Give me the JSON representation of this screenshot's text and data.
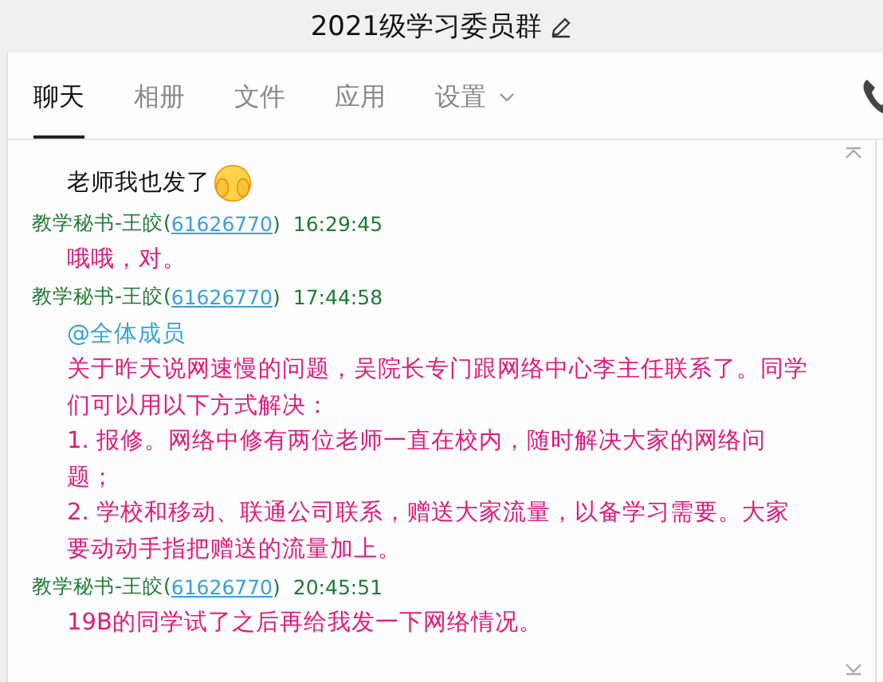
{
  "window": {
    "title": "2021级学习委员群"
  },
  "tabs": [
    {
      "label": "聊天",
      "selected": true,
      "dropdown": false
    },
    {
      "label": "相册",
      "selected": false,
      "dropdown": false
    },
    {
      "label": "文件",
      "selected": false,
      "dropdown": false
    },
    {
      "label": "应用",
      "selected": false,
      "dropdown": false
    },
    {
      "label": "设置",
      "selected": false,
      "dropdown": true
    }
  ],
  "messages": [
    {
      "paragraphs": [
        {
          "kind": "plain",
          "text": "老师我也发了"
        }
      ],
      "emoji": true
    },
    {
      "sender": "教学秘书-王皎(",
      "id": "61626770",
      "id_end": ")",
      "time": "16:29:45",
      "paragraphs": [
        {
          "kind": "highlight",
          "text": "哦哦，对。"
        }
      ],
      "emoji": false
    },
    {
      "sender": "教学秘书-王皎(",
      "id": "61626770",
      "id_end": ")",
      "time": "17:44:58",
      "paragraphs": [
        {
          "kind": "mention",
          "text": "@全体成员"
        },
        {
          "kind": "highlight",
          "text": "关于昨天说网速慢的问题，吴院长专门跟网络中心李主任联系了。同学们可以用以下方式解决："
        },
        {
          "kind": "list",
          "text": "1. 报修。网络中修有两位老师一直在校内，随时解决大家的网络问题；"
        },
        {
          "kind": "list",
          "text": "2. 学校和移动、联通公司联系，赠送大家流量，以备学习需要。大家要动动手指把赠送的流量加上。"
        }
      ],
      "emoji": false
    },
    {
      "sender": "教学秘书-王皎(",
      "id": "61626770",
      "id_end": ")",
      "time": "20:45:51",
      "paragraphs": [
        {
          "kind": "highlight",
          "text": "19B的同学试了之后再给我发一下网络情况。"
        }
      ],
      "emoji": false
    }
  ]
}
